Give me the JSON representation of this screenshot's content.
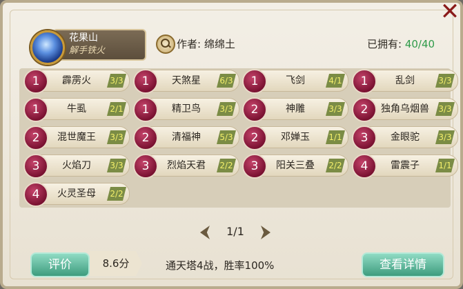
{
  "team": {
    "name": "花果山",
    "subtitle": "解手铁火"
  },
  "author": {
    "text": "作者: 绵绵土"
  },
  "owned": {
    "label": "已拥有:",
    "value": "40/40"
  },
  "cards": [
    {
      "cost": "1",
      "name": "霹雳火",
      "count": "3/3"
    },
    {
      "cost": "1",
      "name": "天煞星",
      "count": "6/3"
    },
    {
      "cost": "1",
      "name": "飞剑",
      "count": "4/1"
    },
    {
      "cost": "1",
      "name": "乱剑",
      "count": "3/3"
    },
    {
      "cost": "1",
      "name": "牛虱",
      "count": "2/1"
    },
    {
      "cost": "1",
      "name": "精卫鸟",
      "count": "3/3"
    },
    {
      "cost": "2",
      "name": "神雕",
      "count": "3/3"
    },
    {
      "cost": "2",
      "name": "独角乌烟兽",
      "count": "3/3"
    },
    {
      "cost": "2",
      "name": "混世魔王",
      "count": "3/3"
    },
    {
      "cost": "2",
      "name": "清福神",
      "count": "5/3"
    },
    {
      "cost": "2",
      "name": "邓婵玉",
      "count": "1/1"
    },
    {
      "cost": "3",
      "name": "金眼驼",
      "count": "3/3"
    },
    {
      "cost": "3",
      "name": "火焰刀",
      "count": "3/3"
    },
    {
      "cost": "3",
      "name": "烈焰天君",
      "count": "2/2"
    },
    {
      "cost": "3",
      "name": "阳关三叠",
      "count": "2/2"
    },
    {
      "cost": "4",
      "name": "雷震子",
      "count": "1/1"
    },
    {
      "cost": "4",
      "name": "火灵圣母",
      "count": "2/2"
    }
  ],
  "pager": {
    "text": "1/1"
  },
  "footer": {
    "rate_label": "评价",
    "score": "8.6分",
    "battle": "通天塔4战，胜率100%",
    "detail_label": "查看详情"
  },
  "colors": {
    "accent": "#2f9b4a",
    "button": "#3e9c7e",
    "cost_badge": "#7b1232",
    "count_tag": "#7b8c45"
  },
  "icons": {
    "close": "close-icon",
    "search": "magnifier-icon",
    "prev": "chevron-left-icon",
    "next": "chevron-right-icon"
  }
}
